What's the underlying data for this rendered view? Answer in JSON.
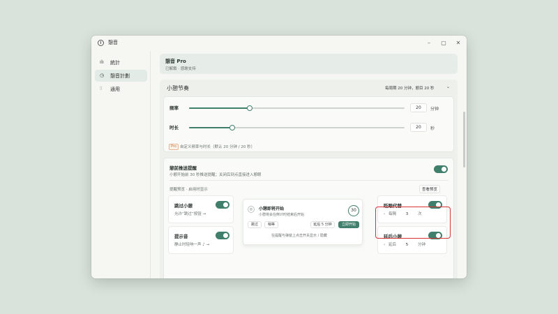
{
  "window": {
    "title": "憩音"
  },
  "sidebar": {
    "items": [
      {
        "label": "統計",
        "icon": "bar-chart-icon"
      },
      {
        "label": "憩音計劃",
        "icon": "clock-icon"
      },
      {
        "label": "通用",
        "icon": "sliders-icon"
      }
    ]
  },
  "banner": {
    "title": "憩音 Pro",
    "subtitle": "已解鎖 · 感謝支持"
  },
  "rhythm": {
    "title": "小憩节奏",
    "summary": "每周期 20 分钟，憩目 20 秒",
    "frequency": {
      "label": "频率",
      "value": "20",
      "unit": "分钟",
      "fraction": 0.28
    },
    "duration": {
      "label": "时长",
      "value": "20",
      "unit": "秒",
      "fraction": 0.2
    },
    "pro_tag": "Pro",
    "pro_note": "自定义频率与时长（默认 20 分钟 / 20 秒）"
  },
  "advance": {
    "title": "憩前推送提醒",
    "desc": "小憩开始前 30 秒推送提醒；关闭后到点直接进入憩眼",
    "preview_caption": "提醒预览 · 启用时显示",
    "preview_button": "查看预览",
    "skip": {
      "title": "跳过小憩",
      "desc": "允许“跳过”按钮 →"
    },
    "sound": {
      "title": "提示音",
      "desc": "静止时轻响一声 ♪ →"
    },
    "popup": {
      "title": "小憩即将开始",
      "desc": "小憩将会在倒计时结束后开始",
      "countdown": "30",
      "btn_skip": "跳过",
      "btn_snooze": "稍等",
      "btn_delay": "延后 5 分钟",
      "btn_start": "立即开始",
      "footer": "在提醒与弹窗上点击开关显示 / 隐藏"
    },
    "alternate": {
      "title": "眨眼代替",
      "prefix": "每隔",
      "value": "3",
      "unit": "次"
    },
    "postpone": {
      "title": "延后小憩",
      "prefix": "延后",
      "value": "5",
      "unit": "分钟"
    }
  },
  "colors": {
    "accent": "#3f7f6b",
    "highlight": "#d9333a",
    "pro": "#c9713f"
  }
}
